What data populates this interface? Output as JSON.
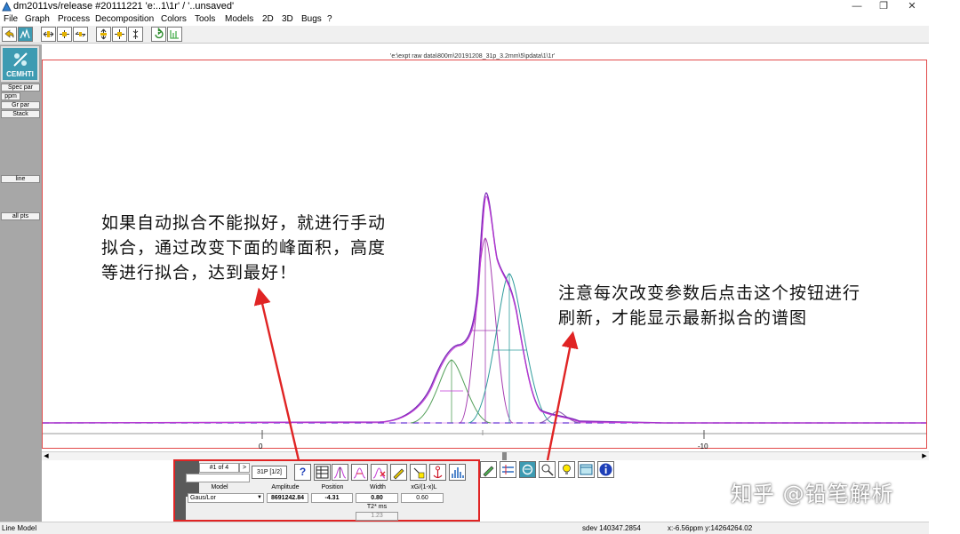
{
  "window": {
    "title": "dm2011vs/release #20111221 'e:..1\\1r' / '..unsaved'",
    "controls": [
      "—",
      "❐",
      "✕"
    ]
  },
  "menu": [
    "File",
    "Graph",
    "Process",
    "Decomposition",
    "Colors",
    "Tools",
    "Models",
    "2D",
    "3D",
    "Bugs",
    "?"
  ],
  "left_panel": {
    "logo": "CEMHTI",
    "buttons": [
      "Spec par",
      "ppm",
      "Gr par",
      "Stack",
      "line",
      "all pts"
    ]
  },
  "plot": {
    "file_path": "'e:\\expt raw data\\800m\\20191208_31p_3.2mm\\5\\pdata\\1\\1r'",
    "axis_ticks": [
      "0",
      "-10"
    ],
    "colors": {
      "frame": "#e24a4a",
      "envelope": "#7a2ab8",
      "model": "#c33ad6",
      "comp_green": "#54a05a",
      "comp_magenta": "#a43ab0",
      "comp_teal": "#2f9c9c",
      "baseline": "#3a3ad6"
    }
  },
  "fit_panel": {
    "line_counter": "#1 of 4",
    "next_label": ">",
    "nucleus": "31P [1/2]",
    "help_label": "?",
    "headers": [
      "Model",
      "Amplitude",
      "Position",
      "Width",
      "xG/(1-x)L"
    ],
    "model_value": "Gaus/Lor",
    "amplitude": "8691242.84",
    "position": "-4.31",
    "width": "0.80",
    "xg": "0.60",
    "t2_label": "T2* ms",
    "t2_value": "1.23"
  },
  "status": {
    "left": "Line Model",
    "sdev": "sdev 140347.2854",
    "cursor": "x:-6.56ppm y:14264264.02"
  },
  "annotations": {
    "left_lines": [
      "如果自动拟合不能拟好，就进行手动",
      "拟合，通过改变下面的峰面积，高度",
      "等进行拟合，达到最好！"
    ],
    "right_lines": [
      "注意每次改变参数后点击这个按钮进行",
      "刷新，才能显示最新拟合的谱图"
    ]
  },
  "watermark": "知乎 @铅笔解析"
}
